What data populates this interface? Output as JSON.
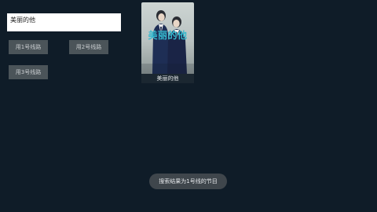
{
  "search": {
    "value": "美丽的他"
  },
  "lines": {
    "btn1": "用1号线路",
    "btn2": "用2号线路",
    "btn3": "用3号线路"
  },
  "results": [
    {
      "title": "美丽的他",
      "poster_logo": "美丽的他"
    }
  ],
  "toast": {
    "message": "搜索结果为1号线的节目"
  },
  "colors": {
    "background": "#0f1c28",
    "button": "#4b5459",
    "poster_logo": "#35b9cf",
    "toast": "#3f464c"
  }
}
